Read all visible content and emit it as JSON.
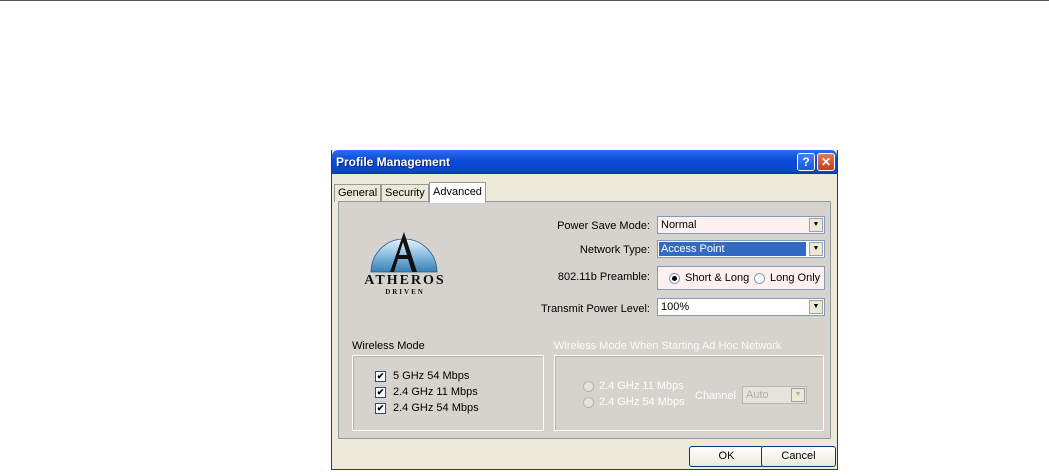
{
  "window": {
    "title": "Profile Management",
    "help_glyph": "?",
    "close_glyph": "✕"
  },
  "tabs": [
    {
      "label": "General"
    },
    {
      "label": "Security"
    },
    {
      "label": "Advanced",
      "selected": true
    }
  ],
  "logo": {
    "line1": "ATHEROS",
    "line2": "DRIVEN",
    "letter": "A"
  },
  "settings": {
    "power_save_label": "Power Save Mode:",
    "power_save_value": "Normal",
    "network_type_label": "Network Type:",
    "network_type_value": "Access Point",
    "preamble_label": "802.11b Preamble:",
    "preamble_options": [
      {
        "label": "Short & Long",
        "selected": true
      },
      {
        "label": "Long Only",
        "selected": false
      }
    ],
    "transmit_label": "Transmit Power Level:",
    "transmit_value": "100%"
  },
  "wireless_mode": {
    "title": "Wireless Mode",
    "options": [
      {
        "label": "5 GHz 54 Mbps",
        "checked": true
      },
      {
        "label": "2.4 GHz 11 Mbps",
        "checked": true
      },
      {
        "label": "2.4 GHz 54 Mbps",
        "checked": true
      }
    ]
  },
  "adhoc": {
    "title": "Wireless Mode When Starting Ad Hoc Network",
    "options": [
      {
        "label": "2.4 GHz 11 Mbps",
        "selected": false
      },
      {
        "label": "2.4 GHz 54 Mbps",
        "selected": false
      }
    ],
    "channel_label": "Channel",
    "channel_value": "Auto",
    "enabled": false
  },
  "buttons": {
    "ok": "OK",
    "cancel": "Cancel"
  },
  "colors": {
    "titlebar": "#0a4ad6",
    "selection": "#316ac5",
    "panel": "#d6d3ce",
    "dialog": "#ece9d8"
  }
}
